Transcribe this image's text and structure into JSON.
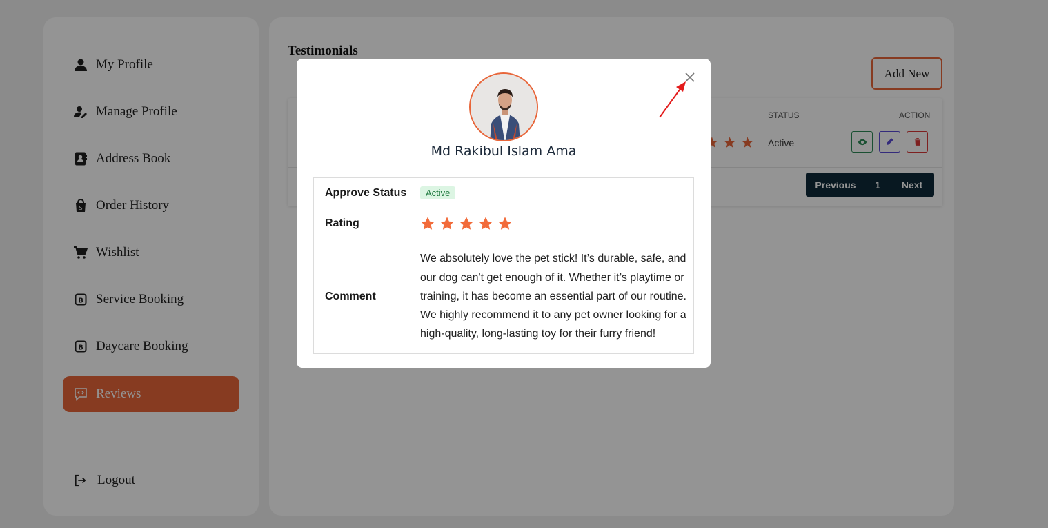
{
  "sidebar": {
    "items": [
      {
        "label": "My Profile",
        "icon": "user-icon"
      },
      {
        "label": "Manage Profile",
        "icon": "user-edit-icon"
      },
      {
        "label": "Address Book",
        "icon": "address-book-icon"
      },
      {
        "label": "Order History",
        "icon": "shopping-bag-icon"
      },
      {
        "label": "Wishlist",
        "icon": "cart-icon"
      },
      {
        "label": "Service Booking",
        "icon": "booking-icon"
      },
      {
        "label": "Daycare Booking",
        "icon": "booking-icon"
      },
      {
        "label": "Reviews",
        "icon": "review-icon",
        "active": true
      }
    ],
    "logout_label": "Logout"
  },
  "main": {
    "title": "Testimonials",
    "add_new_label": "Add New",
    "table": {
      "headers": {
        "status": "STATUS",
        "action": "ACTION"
      },
      "row": {
        "status": "Active"
      }
    },
    "pagination": {
      "previous": "Previous",
      "page": "1",
      "next": "Next"
    }
  },
  "modal": {
    "reviewer_name": "Md Rakibul Islam Ama",
    "rows": {
      "approve_status_label": "Approve Status",
      "approve_status_value": "Active",
      "rating_label": "Rating",
      "rating_value": 5,
      "comment_label": "Comment",
      "comment_value": "We absolutely love the pet stick! It’s durable, safe, and our dog can't get enough of it. Whether it’s playtime or training, it has become an essential part of our routine. We highly recommend it to any pet owner looking for a high-quality, long-lasting toy for their furry friend!"
    }
  },
  "colors": {
    "accent": "#e8663a",
    "navy": "#0e2a3a",
    "success_bg": "#dcf5e3",
    "success_text": "#1f7a3f",
    "annotation_arrow": "#e31b1b"
  }
}
